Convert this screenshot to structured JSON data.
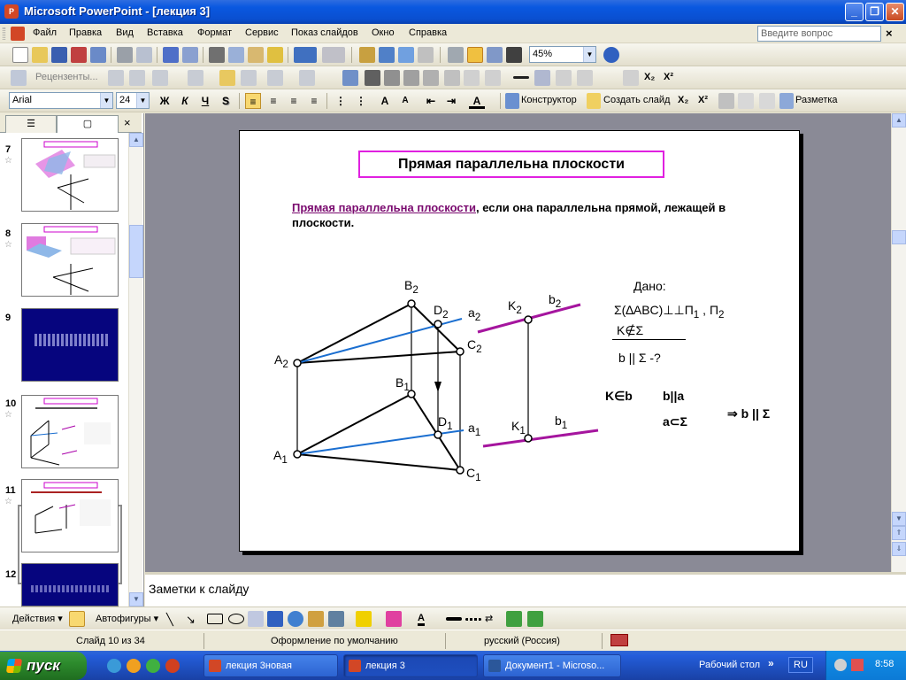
{
  "window": {
    "title": "Microsoft PowerPoint - [лекция 3]",
    "controls": [
      "_",
      "❐",
      "✕"
    ]
  },
  "menu": {
    "items": [
      "Файл",
      "Правка",
      "Вид",
      "Вставка",
      "Формат",
      "Сервис",
      "Показ слайдов",
      "Окно",
      "Справка"
    ],
    "ask_placeholder": "Введите вопрос",
    "close": "×"
  },
  "toolbar_standard": {
    "zoom": "45%"
  },
  "toolbar_review": {
    "review_label": "Рецензенты..."
  },
  "toolbar_format": {
    "font": "Arial",
    "size": "24",
    "bold": "Ж",
    "italic": "К",
    "underline": "Ч",
    "shadow": "S",
    "designer": "Конструктор",
    "new_slide": "Создать слайд",
    "layout": "Разметка"
  },
  "panel": {
    "tab_outline": "☰",
    "tab_slides": "▢",
    "close": "×",
    "thumbnails": [
      {
        "num": "7"
      },
      {
        "num": "8"
      },
      {
        "num": "9"
      },
      {
        "num": "10"
      },
      {
        "num": "11"
      },
      {
        "num": "12"
      }
    ]
  },
  "slide": {
    "title": "Прямая параллельна плоскости",
    "body_highlight": "Прямая параллельна плоскости",
    "body_rest": ", если она параллельна прямой, лежащей в плоскости.",
    "labels": {
      "B": "B",
      "D": "D",
      "C": "C",
      "A": "A",
      "K": "K",
      "b": "b",
      "a": "a",
      "sub1": "1",
      "sub2": "2"
    },
    "given_title": "Дано:",
    "given_line1": "Σ(∆ABC)⊥⊥П",
    "given_line1_sub1": "1",
    "given_line1_mid": " , П",
    "given_line1_sub2": "2",
    "given_line2": "K∉Σ",
    "given_line3": "b || Σ -?",
    "proof_1": "K∈b",
    "proof_2": "b||a",
    "proof_3": "a⊂Σ",
    "conclusion": "⇒ b || Σ"
  },
  "notes": {
    "placeholder": "Заметки к слайду"
  },
  "drawing": {
    "actions": "Действия",
    "autoshapes": "Автофигуры"
  },
  "status": {
    "slide": "Слайд 10 из 34",
    "design": "Оформление по умолчанию",
    "language": "русский (Россия)"
  },
  "taskbar": {
    "start": "пуск",
    "tasks": [
      "лекция 3новая",
      "лекция 3",
      "Документ1 - Microso..."
    ],
    "desktop": "Рабочий стол",
    "lang": "RU",
    "time": "8:58"
  }
}
